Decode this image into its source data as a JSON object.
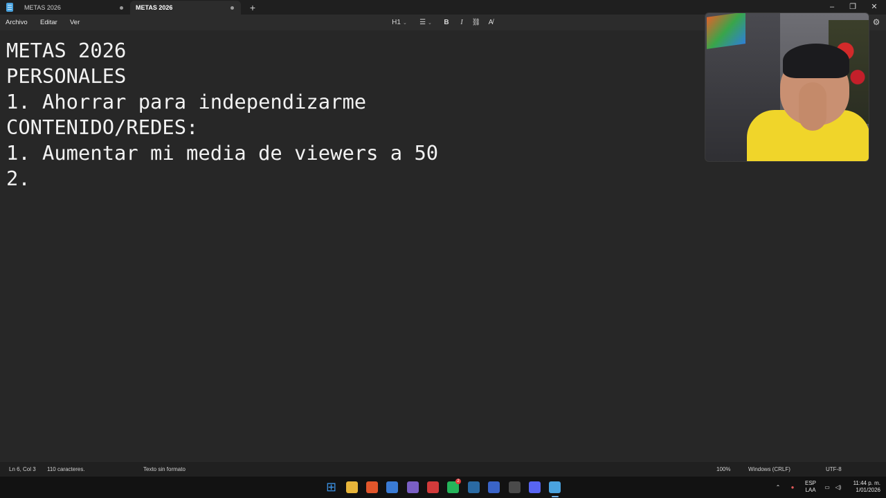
{
  "tabs": [
    {
      "label": "METAS 2026",
      "active": false
    },
    {
      "label": "METAS 2026",
      "active": true
    }
  ],
  "window_controls": {
    "minimize": "–",
    "maximize": "❐",
    "close": "✕"
  },
  "menu": [
    "Archivo",
    "Editar",
    "Ver"
  ],
  "format_toolbar": {
    "heading": "H1",
    "list": "☰",
    "bold": "B",
    "italic": "I",
    "link": "⛓",
    "clear_format": "A̸"
  },
  "document": {
    "lines": [
      "METAS 2026",
      "PERSONALES",
      "1. Ahorrar para independizarme",
      "CONTENIDO/REDES:",
      "1. Aumentar mi media de viewers a 50",
      "2. "
    ]
  },
  "status": {
    "position": "Ln 6, Col 3",
    "characters": "110 caracteres.",
    "format": "Texto sin formato",
    "zoom": "100%",
    "line_endings": "Windows (CRLF)",
    "encoding": "UTF-8"
  },
  "taskbar": {
    "apps": [
      {
        "name": "start",
        "color": "#3b8fe0"
      },
      {
        "name": "file-explorer",
        "color": "#e8b53a"
      },
      {
        "name": "brave",
        "color": "#e2562b"
      },
      {
        "name": "store",
        "color": "#3a7bd5"
      },
      {
        "name": "game-app",
        "color": "#7a5fc4"
      },
      {
        "name": "media-app",
        "color": "#d23a3a"
      },
      {
        "name": "whatsapp",
        "color": "#25b45a",
        "badge": "2"
      },
      {
        "name": "steam",
        "color": "#2a6aa3"
      },
      {
        "name": "browser",
        "color": "#3a64c8"
      },
      {
        "name": "obs",
        "color": "#4a4a4a"
      },
      {
        "name": "discord",
        "color": "#5865f2"
      },
      {
        "name": "notepad",
        "color": "#4aa3df"
      }
    ],
    "language_top": "ESP",
    "language_bottom": "LAA",
    "time": "11:44 p. m.",
    "date": "1/01/2026"
  }
}
